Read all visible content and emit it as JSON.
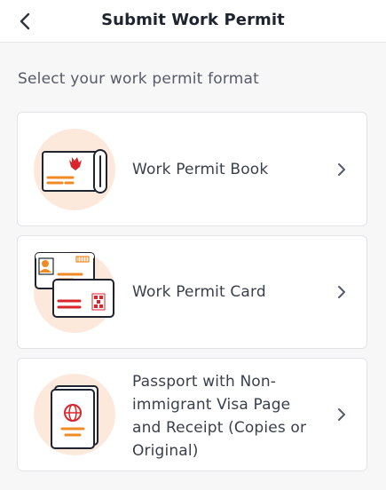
{
  "header": {
    "title": "Submit Work Permit",
    "back_icon": "chevron-left-icon"
  },
  "subtitle": "Select your work permit format",
  "options": [
    {
      "label": "Work Permit Book",
      "icon": "work-permit-book-icon"
    },
    {
      "label": "Work Permit Card",
      "icon": "work-permit-card-icon"
    },
    {
      "label": "Passport with Non-immigrant Visa Page and Receipt (Copies or Original)",
      "icon": "passport-icon"
    }
  ],
  "colors": {
    "accent_orange": "#f08a24",
    "accent_red": "#d9262c",
    "icon_background": "#fde9dc",
    "outline": "#1f2430"
  }
}
